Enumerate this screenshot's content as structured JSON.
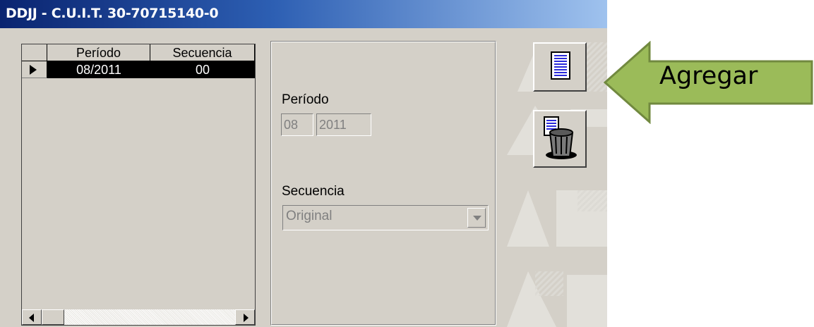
{
  "window": {
    "title": "DDJJ - C.U.I.T. 30-70715140-0"
  },
  "grid": {
    "columns": [
      "Período",
      "Secuencia"
    ],
    "rows": [
      {
        "periodo": "08/2011",
        "secuencia": "00"
      }
    ]
  },
  "form": {
    "periodo_label": "Período",
    "periodo_month": "08",
    "periodo_year": "2011",
    "secuencia_label": "Secuencia",
    "secuencia_value": "Original"
  },
  "toolbar": {
    "add_icon": "document-list-icon",
    "delete_icon": "trash-document-icon"
  },
  "callout": {
    "label": "Agregar",
    "color": "#9bbb59",
    "border": "#71893f"
  }
}
